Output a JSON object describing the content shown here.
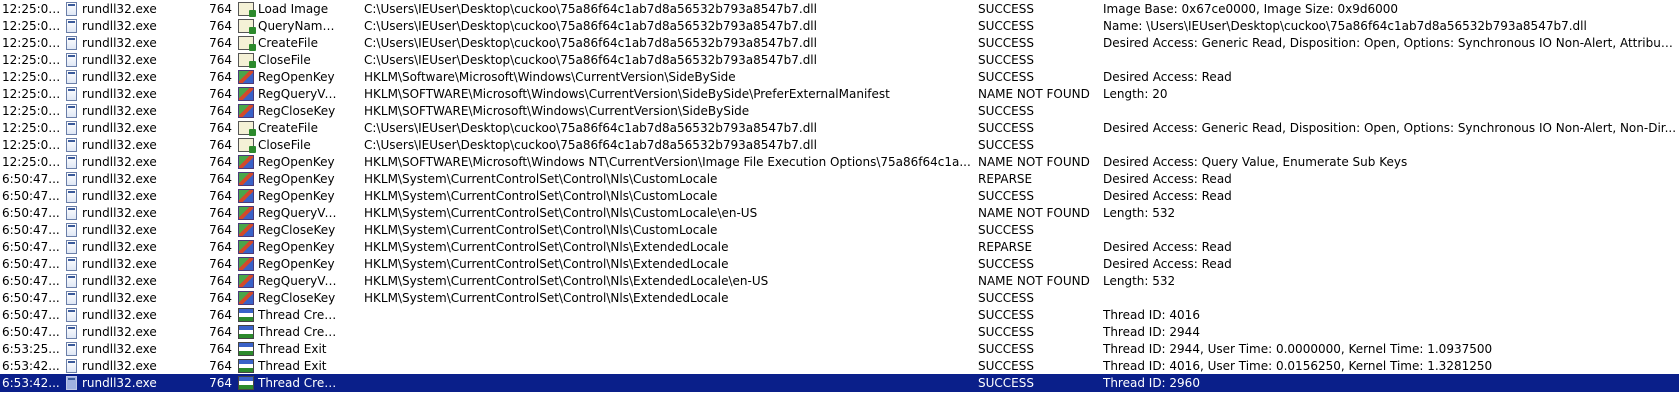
{
  "colors": {
    "selected_row_bg": "#0a1f8a",
    "selected_row_text": "#ffffff",
    "background": "#ffffff"
  },
  "rows": [
    {
      "time": "12:25:00...",
      "process": "rundll32.exe",
      "pid": "764",
      "op_icon": "file-system-icon",
      "operation": "Load Image",
      "path": "C:\\Users\\IEUser\\Desktop\\cuckoo\\75a86f64c1ab7d8a56532b793a8547b7.dll",
      "result": "SUCCESS",
      "detail": "Image Base: 0x67ce0000, Image Size: 0x9d6000"
    },
    {
      "time": "12:25:00...",
      "process": "rundll32.exe",
      "pid": "764",
      "op_icon": "file-system-icon",
      "operation": "QueryNameInfo...",
      "path": "C:\\Users\\IEUser\\Desktop\\cuckoo\\75a86f64c1ab7d8a56532b793a8547b7.dll",
      "result": "SUCCESS",
      "detail": "Name: \\Users\\IEUser\\Desktop\\cuckoo\\75a86f64c1ab7d8a56532b793a8547b7.dll"
    },
    {
      "time": "12:25:00...",
      "process": "rundll32.exe",
      "pid": "764",
      "op_icon": "file-system-icon",
      "operation": "CreateFile",
      "path": "C:\\Users\\IEUser\\Desktop\\cuckoo\\75a86f64c1ab7d8a56532b793a8547b7.dll",
      "result": "SUCCESS",
      "detail": "Desired Access: Generic Read, Disposition: Open, Options: Synchronous IO Non-Alert, Attribute..."
    },
    {
      "time": "12:25:00...",
      "process": "rundll32.exe",
      "pid": "764",
      "op_icon": "file-system-icon",
      "operation": "CloseFile",
      "path": "C:\\Users\\IEUser\\Desktop\\cuckoo\\75a86f64c1ab7d8a56532b793a8547b7.dll",
      "result": "SUCCESS",
      "detail": ""
    },
    {
      "time": "12:25:00...",
      "process": "rundll32.exe",
      "pid": "764",
      "op_icon": "registry-icon",
      "operation": "RegOpenKey",
      "path": "HKLM\\Software\\Microsoft\\Windows\\CurrentVersion\\SideBySide",
      "result": "SUCCESS",
      "detail": "Desired Access: Read"
    },
    {
      "time": "12:25:00...",
      "process": "rundll32.exe",
      "pid": "764",
      "op_icon": "registry-icon",
      "operation": "RegQueryValue",
      "path": "HKLM\\SOFTWARE\\Microsoft\\Windows\\CurrentVersion\\SideBySide\\PreferExternalManifest",
      "result": "NAME NOT FOUND",
      "detail": "Length: 20"
    },
    {
      "time": "12:25:00...",
      "process": "rundll32.exe",
      "pid": "764",
      "op_icon": "registry-icon",
      "operation": "RegCloseKey",
      "path": "HKLM\\SOFTWARE\\Microsoft\\Windows\\CurrentVersion\\SideBySide",
      "result": "SUCCESS",
      "detail": ""
    },
    {
      "time": "12:25:00...",
      "process": "rundll32.exe",
      "pid": "764",
      "op_icon": "file-system-icon",
      "operation": "CreateFile",
      "path": "C:\\Users\\IEUser\\Desktop\\cuckoo\\75a86f64c1ab7d8a56532b793a8547b7.dll",
      "result": "SUCCESS",
      "detail": "Desired Access: Generic Read, Disposition: Open, Options: Synchronous IO Non-Alert, Non-Dir..."
    },
    {
      "time": "12:25:00...",
      "process": "rundll32.exe",
      "pid": "764",
      "op_icon": "file-system-icon",
      "operation": "CloseFile",
      "path": "C:\\Users\\IEUser\\Desktop\\cuckoo\\75a86f64c1ab7d8a56532b793a8547b7.dll",
      "result": "SUCCESS",
      "detail": ""
    },
    {
      "time": "12:25:00...",
      "process": "rundll32.exe",
      "pid": "764",
      "op_icon": "registry-icon",
      "operation": "RegOpenKey",
      "path": "HKLM\\SOFTWARE\\Microsoft\\Windows NT\\CurrentVersion\\Image File Execution Options\\75a86f64c1a...",
      "result": "NAME NOT FOUND",
      "detail": "Desired Access: Query Value, Enumerate Sub Keys"
    },
    {
      "time": "6:50:47...",
      "process": "rundll32.exe",
      "pid": "764",
      "op_icon": "registry-icon",
      "operation": "RegOpenKey",
      "path": "HKLM\\System\\CurrentControlSet\\Control\\Nls\\CustomLocale",
      "result": "REPARSE",
      "detail": "Desired Access: Read"
    },
    {
      "time": "6:50:47...",
      "process": "rundll32.exe",
      "pid": "764",
      "op_icon": "registry-icon",
      "operation": "RegOpenKey",
      "path": "HKLM\\System\\CurrentControlSet\\Control\\Nls\\CustomLocale",
      "result": "SUCCESS",
      "detail": "Desired Access: Read"
    },
    {
      "time": "6:50:47...",
      "process": "rundll32.exe",
      "pid": "764",
      "op_icon": "registry-icon",
      "operation": "RegQueryValue",
      "path": "HKLM\\System\\CurrentControlSet\\Control\\Nls\\CustomLocale\\en-US",
      "result": "NAME NOT FOUND",
      "detail": "Length: 532"
    },
    {
      "time": "6:50:47...",
      "process": "rundll32.exe",
      "pid": "764",
      "op_icon": "registry-icon",
      "operation": "RegCloseKey",
      "path": "HKLM\\System\\CurrentControlSet\\Control\\Nls\\CustomLocale",
      "result": "SUCCESS",
      "detail": ""
    },
    {
      "time": "6:50:47...",
      "process": "rundll32.exe",
      "pid": "764",
      "op_icon": "registry-icon",
      "operation": "RegOpenKey",
      "path": "HKLM\\System\\CurrentControlSet\\Control\\Nls\\ExtendedLocale",
      "result": "REPARSE",
      "detail": "Desired Access: Read"
    },
    {
      "time": "6:50:47...",
      "process": "rundll32.exe",
      "pid": "764",
      "op_icon": "registry-icon",
      "operation": "RegOpenKey",
      "path": "HKLM\\System\\CurrentControlSet\\Control\\Nls\\ExtendedLocale",
      "result": "SUCCESS",
      "detail": "Desired Access: Read"
    },
    {
      "time": "6:50:47...",
      "process": "rundll32.exe",
      "pid": "764",
      "op_icon": "registry-icon",
      "operation": "RegQueryValue",
      "path": "HKLM\\System\\CurrentControlSet\\Control\\Nls\\ExtendedLocale\\en-US",
      "result": "NAME NOT FOUND",
      "detail": "Length: 532"
    },
    {
      "time": "6:50:47...",
      "process": "rundll32.exe",
      "pid": "764",
      "op_icon": "registry-icon",
      "operation": "RegCloseKey",
      "path": "HKLM\\System\\CurrentControlSet\\Control\\Nls\\ExtendedLocale",
      "result": "SUCCESS",
      "detail": ""
    },
    {
      "time": "6:50:47...",
      "process": "rundll32.exe",
      "pid": "764",
      "op_icon": "thread-icon",
      "operation": "Thread Create",
      "path": "",
      "result": "SUCCESS",
      "detail": "Thread ID: 4016"
    },
    {
      "time": "6:50:47...",
      "process": "rundll32.exe",
      "pid": "764",
      "op_icon": "thread-icon",
      "operation": "Thread Create",
      "path": "",
      "result": "SUCCESS",
      "detail": "Thread ID: 2944"
    },
    {
      "time": "6:53:25...",
      "process": "rundll32.exe",
      "pid": "764",
      "op_icon": "thread-icon",
      "operation": "Thread Exit",
      "path": "",
      "result": "SUCCESS",
      "detail": "Thread ID: 2944, User Time: 0.0000000, Kernel Time: 1.0937500"
    },
    {
      "time": "6:53:42...",
      "process": "rundll32.exe",
      "pid": "764",
      "op_icon": "thread-icon",
      "operation": "Thread Exit",
      "path": "",
      "result": "SUCCESS",
      "detail": "Thread ID: 4016, User Time: 0.0156250, Kernel Time: 1.3281250"
    },
    {
      "time": "6:53:42...",
      "process": "rundll32.exe",
      "pid": "764",
      "op_icon": "thread-icon",
      "operation": "Thread Create",
      "path": "",
      "result": "SUCCESS",
      "detail": "Thread ID: 2960",
      "selected": true
    }
  ]
}
